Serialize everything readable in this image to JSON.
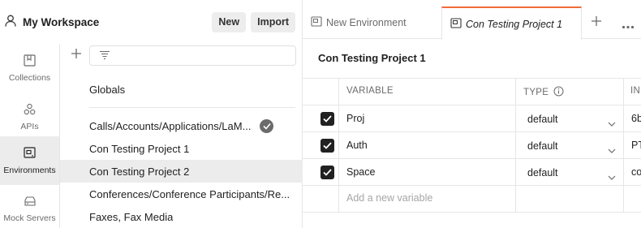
{
  "workspace": {
    "title": "My Workspace",
    "new_label": "New",
    "import_label": "Import"
  },
  "rail": {
    "items": [
      {
        "label": "Collections",
        "icon": "collections-icon"
      },
      {
        "label": "APIs",
        "icon": "apis-icon"
      },
      {
        "label": "Environments",
        "icon": "environments-icon",
        "active": true
      },
      {
        "label": "Mock Servers",
        "icon": "mock-servers-icon"
      }
    ]
  },
  "env_list": {
    "globals": "Globals",
    "items": [
      {
        "name": "Calls/Accounts/Applications/LaM...",
        "active_check": true
      },
      {
        "name": "Con Testing Project 1"
      },
      {
        "name": "Con Testing Project 2",
        "selected": true
      },
      {
        "name": "Conferences/Conference Participants/Re..."
      },
      {
        "name": "Faxes, Fax Media"
      }
    ]
  },
  "tabs": [
    {
      "label": "New Environment"
    },
    {
      "label": "Con Testing Project 1",
      "active": true
    }
  ],
  "editor": {
    "title": "Con Testing Project 1",
    "columns": {
      "variable": "VARIABLE",
      "type": "TYPE",
      "initial": "IN"
    },
    "rows": [
      {
        "checked": true,
        "variable": "Proj",
        "type": "default",
        "initial": "6b"
      },
      {
        "checked": true,
        "variable": "Auth",
        "type": "default",
        "initial": "PT"
      },
      {
        "checked": true,
        "variable": "Space",
        "type": "default",
        "initial": "co"
      }
    ],
    "add_placeholder": "Add a new variable"
  },
  "colors": {
    "accent": "#f26b3a",
    "selected_bg": "#ececec"
  }
}
